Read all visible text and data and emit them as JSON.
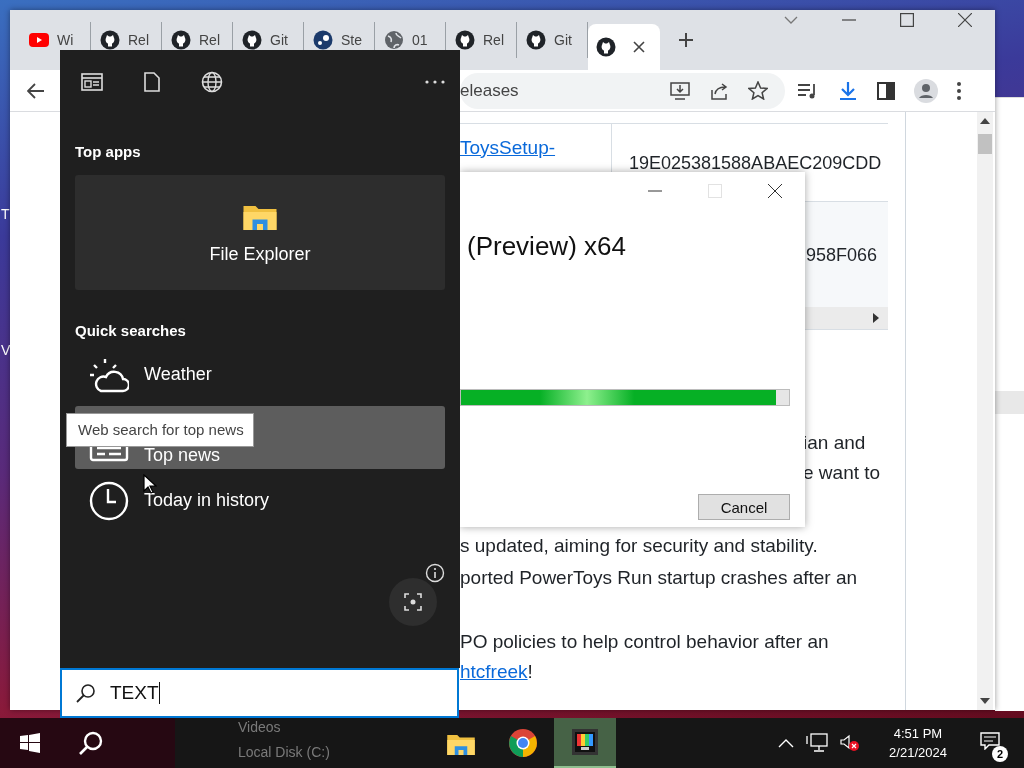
{
  "desktop": {
    "labels": [
      "T",
      "V"
    ]
  },
  "browser": {
    "tabs": [
      {
        "kind": "youtube",
        "title": "Wi",
        "selected": false
      },
      {
        "kind": "github",
        "title": "Rel",
        "selected": false
      },
      {
        "kind": "github",
        "title": "Rel",
        "selected": false
      },
      {
        "kind": "github",
        "title": "Git",
        "selected": false
      },
      {
        "kind": "steam",
        "title": "Ste",
        "selected": false
      },
      {
        "kind": "globe",
        "title": "01",
        "selected": false
      },
      {
        "kind": "github",
        "title": "Rel",
        "selected": false
      },
      {
        "kind": "github",
        "title": "Git",
        "selected": false
      },
      {
        "kind": "github",
        "selected": true
      }
    ],
    "address": "eleases",
    "table": {
      "rows": [
        {
          "file_link": "ToysSetup-",
          "hash": "19E025381588ABAEC209CDD"
        },
        {
          "hash": "958F066"
        }
      ]
    },
    "paragraphs": [
      {
        "lines": [
          [
            {
              "text": "ian and"
            }
          ],
          [
            {
              "text": "e want to"
            }
          ]
        ]
      },
      {
        "lines": [
          [
            {
              "text": "s updated, aiming for security and stability."
            }
          ]
        ]
      },
      {
        "lines": [
          [
            {
              "text": "ported PowerToys Run startup crashes after an"
            }
          ]
        ]
      },
      {
        "lines": [
          [
            {
              "text": "PO policies to help control behavior after an"
            }
          ],
          [
            {
              "text": "htcfreek",
              "link": true
            },
            {
              "text": "!"
            }
          ]
        ]
      }
    ]
  },
  "installer": {
    "title": "(Preview) x64",
    "level": 0.96,
    "cancel": "Cancel",
    "maximize_disabled": true
  },
  "search_panel": {
    "top_apps_heading": "Top apps",
    "top_apps": [
      {
        "kind": "folder",
        "label": "File Explorer"
      }
    ],
    "quick_searches_heading": "Quick searches",
    "quick_searches": [
      {
        "kind": "weather",
        "label": "Weather",
        "selected": false
      },
      {
        "kind": "news",
        "label": "Top news",
        "selected": true
      },
      {
        "kind": "history",
        "label": "Today in history",
        "selected": false
      }
    ],
    "tooltip": "Web search for top news",
    "query": "TEXT"
  },
  "taskbar": {
    "background_items": [
      "Videos",
      "Local Disk (C:)"
    ],
    "apps": [
      {
        "kind": "folder",
        "selected": false
      },
      {
        "kind": "chrome",
        "selected": false
      },
      {
        "kind": "powertoys",
        "selected": true
      }
    ],
    "time": "4:51 PM",
    "date": "2/21/2024",
    "notifications": "2"
  }
}
